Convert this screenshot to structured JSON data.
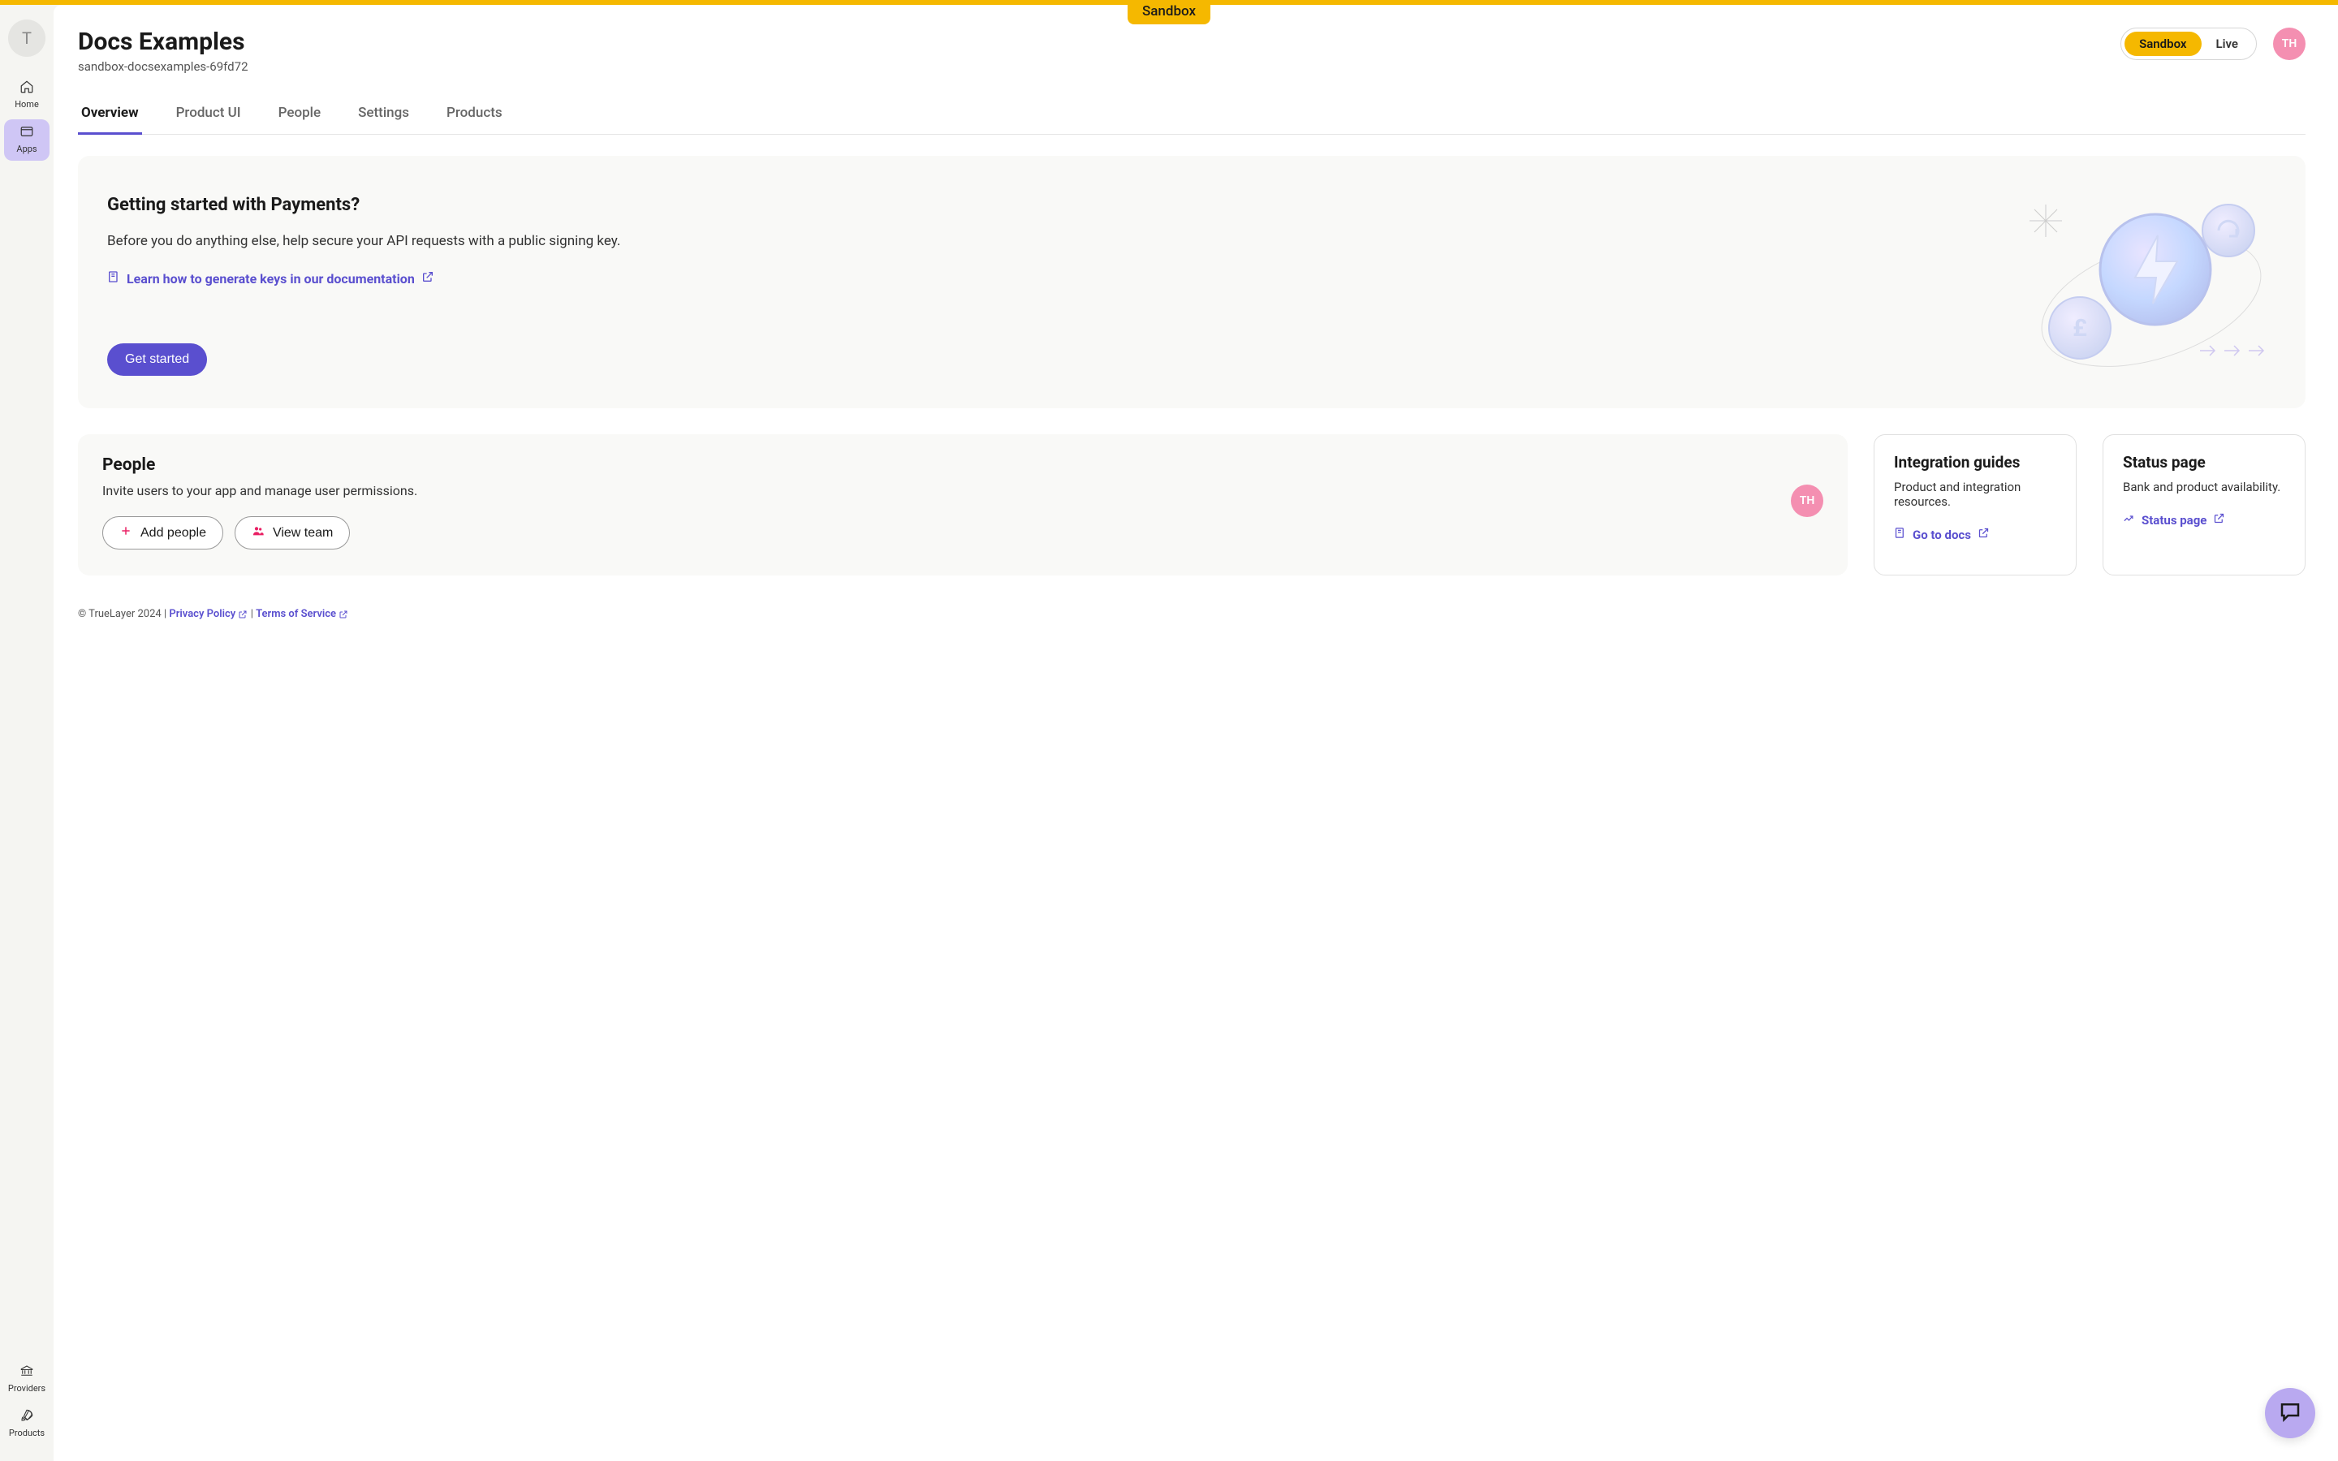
{
  "top_badge": "Sandbox",
  "sidebar": {
    "avatar_initial": "T",
    "items": [
      {
        "label": "Home"
      },
      {
        "label": "Apps"
      }
    ],
    "bottom_items": [
      {
        "label": "Providers"
      },
      {
        "label": "Products"
      }
    ]
  },
  "header": {
    "title": "Docs Examples",
    "subtitle": "sandbox-docsexamples-69fd72",
    "env_options": {
      "sandbox": "Sandbox",
      "live": "Live"
    },
    "user_initials": "TH"
  },
  "tabs": [
    {
      "label": "Overview",
      "active": true
    },
    {
      "label": "Product UI"
    },
    {
      "label": "People"
    },
    {
      "label": "Settings"
    },
    {
      "label": "Products"
    }
  ],
  "hero": {
    "title": "Getting started with Payments?",
    "body": "Before you do anything else, help secure your API requests with a public signing key.",
    "link_text": "Learn how to generate keys in our documentation",
    "cta": "Get started"
  },
  "people_card": {
    "title": "People",
    "body": "Invite users to your app and manage user permissions.",
    "add_label": "Add people",
    "view_label": "View team",
    "avatar_initials": "TH"
  },
  "guides_card": {
    "title": "Integration guides",
    "body": "Product and integration resources.",
    "link_label": "Go to docs"
  },
  "status_card": {
    "title": "Status page",
    "body": "Bank and product availability.",
    "link_label": "Status page"
  },
  "footer": {
    "copyright": "© TrueLayer 2024",
    "privacy": "Privacy Policy",
    "terms": "Terms of Service"
  }
}
